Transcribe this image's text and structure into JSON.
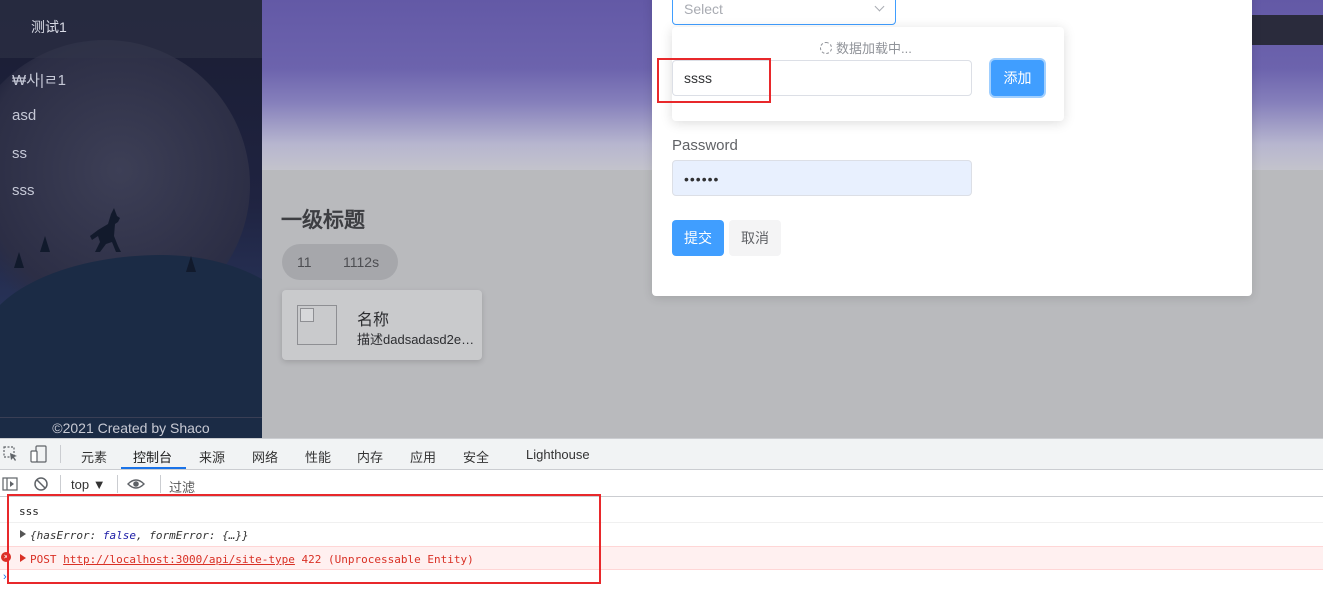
{
  "sidebar": {
    "title": "测试1",
    "items": [
      "₩사|ㄹ1",
      "asd",
      "ss",
      "sss"
    ],
    "footer": "©2021 Created by Shaco"
  },
  "main": {
    "heading": "一级标题",
    "tags": [
      "11",
      "1112s"
    ],
    "card": {
      "name": "名称",
      "desc": "描述dadsadasd2e…"
    }
  },
  "form": {
    "select_placeholder": "Select",
    "loading_text": "数据加载中...",
    "type_input_value": "ssss",
    "add_button": "添加",
    "password_label": "Password",
    "password_value": "••••••",
    "submit_button": "提交",
    "cancel_button": "取消"
  },
  "devtools": {
    "tabs": [
      "元素",
      "控制台",
      "来源",
      "网络",
      "性能",
      "内存",
      "应用",
      "安全",
      "Lighthouse"
    ],
    "active_tab": "控制台",
    "context": "top",
    "filter_placeholder": "过滤",
    "logs": {
      "line1": "sss",
      "line2_prefix": "{hasError: ",
      "line2_kw": "false",
      "line2_suffix": ", formError: {…}}",
      "line3_method": "POST ",
      "line3_url": "http://localhost:3000/api/site-type",
      "line3_status": " 422 (Unprocessable Entity)"
    }
  },
  "colors": {
    "primary": "#409eff",
    "error": "#d93025",
    "highlight": "#e8282b"
  }
}
